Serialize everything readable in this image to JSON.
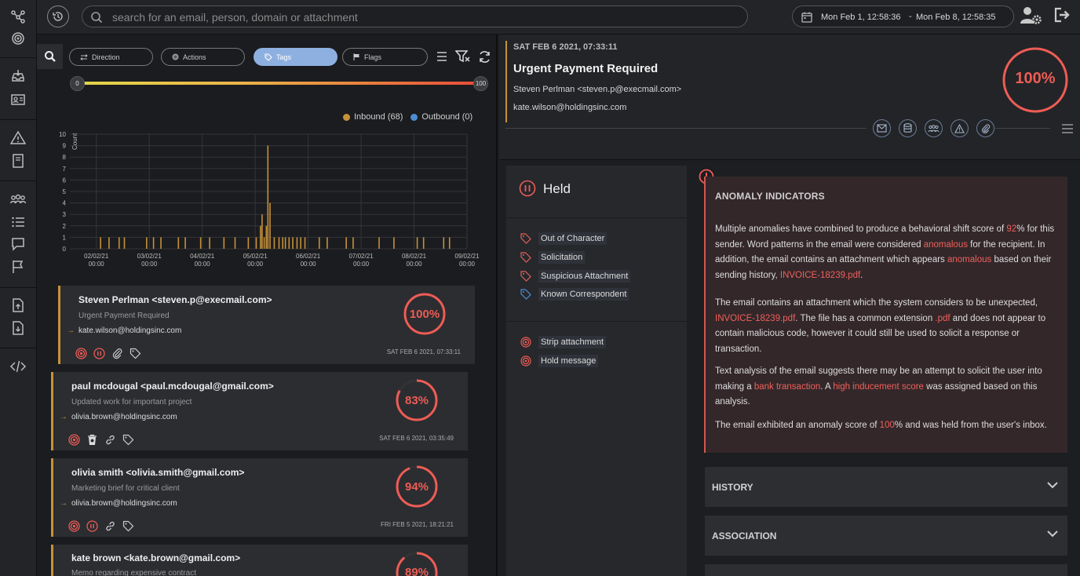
{
  "search": {
    "placeholder": "search for an email, person, domain or attachment"
  },
  "date_range": {
    "start": "Mon Feb 1, 12:58:36",
    "separator": "-",
    "end": "Mon Feb 8, 12:58:35"
  },
  "filters": {
    "pills": [
      {
        "label": "Direction",
        "icon": "swap-arrows-icon",
        "active": false
      },
      {
        "label": "Actions",
        "icon": "target-icon",
        "active": false
      },
      {
        "label": "Tags",
        "icon": "tag-icon",
        "active": true
      },
      {
        "label": "Flags",
        "icon": "flag-icon",
        "active": false
      }
    ],
    "score_min": "0",
    "score_max": "100"
  },
  "chart_data": {
    "type": "bar",
    "ylabel": "Count",
    "ylim": [
      0,
      10
    ],
    "yticks": [
      "0",
      "1",
      "2",
      "3",
      "4",
      "5",
      "6",
      "7",
      "8",
      "9",
      "10"
    ],
    "xticks": [
      {
        "date": "02/02/21",
        "time": "00:00"
      },
      {
        "date": "03/02/21",
        "time": "00:00"
      },
      {
        "date": "04/02/21",
        "time": "00:00"
      },
      {
        "date": "05/02/21",
        "time": "00:00"
      },
      {
        "date": "06/02/21",
        "time": "00:00"
      },
      {
        "date": "07/02/21",
        "time": "00:00"
      },
      {
        "date": "08/02/21",
        "time": "00:00"
      },
      {
        "date": "09/02/21",
        "time": "00:00"
      }
    ],
    "legend": [
      {
        "label": "Inbound (68)",
        "color": "#c6913a"
      },
      {
        "label": "Outbound (0)",
        "color": "#4b8ed1"
      }
    ],
    "series": [
      {
        "name": "Inbound",
        "color": "#c6913a",
        "points": [
          [
            0.08,
            1
          ],
          [
            0.24,
            1
          ],
          [
            0.43,
            1
          ],
          [
            0.53,
            1
          ],
          [
            0.95,
            1
          ],
          [
            1.08,
            1
          ],
          [
            1.22,
            1
          ],
          [
            1.55,
            1
          ],
          [
            1.68,
            1
          ],
          [
            1.97,
            1
          ],
          [
            2.14,
            1
          ],
          [
            2.41,
            1
          ],
          [
            2.62,
            1
          ],
          [
            2.87,
            1
          ],
          [
            3.02,
            1
          ],
          [
            3.1,
            2
          ],
          [
            3.13,
            3
          ],
          [
            3.17,
            1
          ],
          [
            3.21,
            2
          ],
          [
            3.24,
            9
          ],
          [
            3.28,
            4
          ],
          [
            3.36,
            1
          ],
          [
            3.45,
            1
          ],
          [
            3.52,
            1
          ],
          [
            3.57,
            1
          ],
          [
            3.64,
            1
          ],
          [
            3.71,
            1
          ],
          [
            3.79,
            1
          ],
          [
            3.86,
            1
          ],
          [
            3.94,
            1
          ],
          [
            4.21,
            1
          ],
          [
            4.36,
            1
          ],
          [
            4.72,
            1
          ],
          [
            4.85,
            1
          ],
          [
            5.34,
            1
          ],
          [
            5.62,
            1
          ],
          [
            6.06,
            1
          ],
          [
            6.18,
            1
          ],
          [
            6.56,
            1
          ],
          [
            6.67,
            1
          ]
        ]
      },
      {
        "name": "Outbound",
        "color": "#4b8ed1",
        "points": []
      }
    ]
  },
  "emails": [
    {
      "sender": "Steven Perlman <steven.p@execmail.com>",
      "subject": "Urgent Payment Required",
      "recipient": "kate.wilson@holdingsinc.com",
      "date": "SAT FEB 6 2021, 07:33:11",
      "score": "100%",
      "score_value": 100,
      "icons": [
        "strip-attachment-icon",
        "hold-icon",
        "paperclip-icon",
        "tag-icon"
      ],
      "selected": true
    },
    {
      "sender": "paul mcdougal <paul.mcdougal@gmail.com>",
      "subject": "Updated work for important project",
      "recipient": "olivia.brown@holdingsinc.com",
      "date": "SAT FEB 6 2021, 03:35:49",
      "score": "83%",
      "score_value": 83,
      "icons": [
        "strip-attachment-icon",
        "trash-icon",
        "link-icon",
        "tag-icon"
      ],
      "selected": false
    },
    {
      "sender": "olivia smith <olivia.smith@gmail.com>",
      "subject": "Marketing brief for critical client",
      "recipient": "olivia.brown@holdingsinc.com",
      "date": "FRI FEB 5 2021, 18:21:21",
      "score": "94%",
      "score_value": 94,
      "icons": [
        "strip-attachment-icon",
        "hold-icon",
        "link-icon",
        "tag-icon"
      ],
      "selected": false
    },
    {
      "sender": "kate brown <kate.brown@gmail.com>",
      "subject": "Memo regarding expensive contract",
      "score": "89%",
      "score_value": 89,
      "selected": false
    }
  ],
  "message": {
    "date": "SAT FEB 6 2021, 07:33:11",
    "subject": "Urgent Payment Required",
    "from": "Steven Perlman <steven.p@execmail.com>",
    "to": "kate.wilson@holdingsinc.com",
    "score": "100%",
    "score_value": 100,
    "action_icons": [
      "envelope-icon",
      "database-icon",
      "group-icon",
      "warning-icon",
      "paperclip-icon"
    ]
  },
  "held": {
    "title": "Held",
    "tags": [
      {
        "label": "Out of Character",
        "color": "#e0605a"
      },
      {
        "label": "Solicitation",
        "color": "#e0605a"
      },
      {
        "label": "Suspicious Attachment",
        "color": "#e0605a"
      },
      {
        "label": "Known Correspondent",
        "color": "#4b8ed1"
      }
    ],
    "actions": [
      {
        "label": "Strip attachment"
      },
      {
        "label": "Hold message"
      }
    ]
  },
  "anomaly": {
    "title": "ANOMALY INDICATORS",
    "p1": {
      "t1": "Multiple anomalies have combined to produce a behavioral shift score of ",
      "h1": "92",
      "t2": "% for this sender. Word patterns in the email were considered ",
      "h2": "anomalous",
      "t3": " for the recipient. In addition, the email contains an attachment which appears ",
      "h3": "anomalous",
      "t4": " based on their sending history, ",
      "h4": "INVOICE-18239.pdf",
      "t5": "."
    },
    "p2": {
      "t1": "The email contains an attachment which the system considers to be unexpected, ",
      "h1": "INVOICE-18239.pdf",
      "t2": ". The file has a common extension ",
      "h2": ".pdf",
      "t3": " and does not appear to contain malicious code, however it could still be used to solicit a response or transaction."
    },
    "p3": {
      "t1": "Text analysis of the email suggests there may be an attempt to solicit the user into making a ",
      "h1": "bank transaction",
      "t2": ". A ",
      "h2": "high inducement score",
      "t3": " was assigned based on this analysis."
    },
    "p4": {
      "t1": "The email exhibited an anomaly score of ",
      "h1": "100",
      "t2": "% and was held from the user's inbox."
    }
  },
  "sections": [
    {
      "title": "HISTORY"
    },
    {
      "title": "ASSOCIATION"
    }
  ],
  "colors": {
    "accent_gold": "#c6913a",
    "danger": "#ee5c55",
    "info": "#4b8ed1"
  }
}
